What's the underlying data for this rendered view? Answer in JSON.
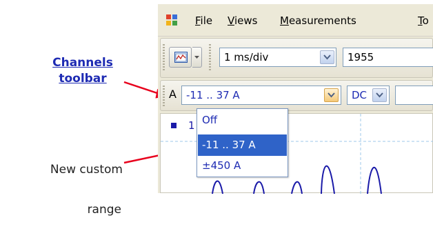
{
  "annotations": {
    "channels_toolbar_line1": "Channels",
    "channels_toolbar_line2": "toolbar",
    "custom_range_line1": "New custom",
    "custom_range_line2": "range"
  },
  "menu": {
    "file": "File",
    "views": "Views",
    "measurements": "Measurements",
    "tools": "To"
  },
  "toolbar": {
    "timebase_value": "1 ms/div",
    "samples_value": "1955"
  },
  "channel_toolbar": {
    "channel_label": "A",
    "range_value": "-11 .. 37 A",
    "coupling_value": "DC"
  },
  "range_dropdown": {
    "options": [
      "Off",
      "-11 .. 37 A",
      "±450 A"
    ],
    "selected_index": 1
  },
  "scope": {
    "legend_partial": "1"
  },
  "colors": {
    "accent": "#2f63c8",
    "link": "#1e2bb3",
    "arrow": "#e8001c",
    "trace": "#1a1aa8"
  }
}
